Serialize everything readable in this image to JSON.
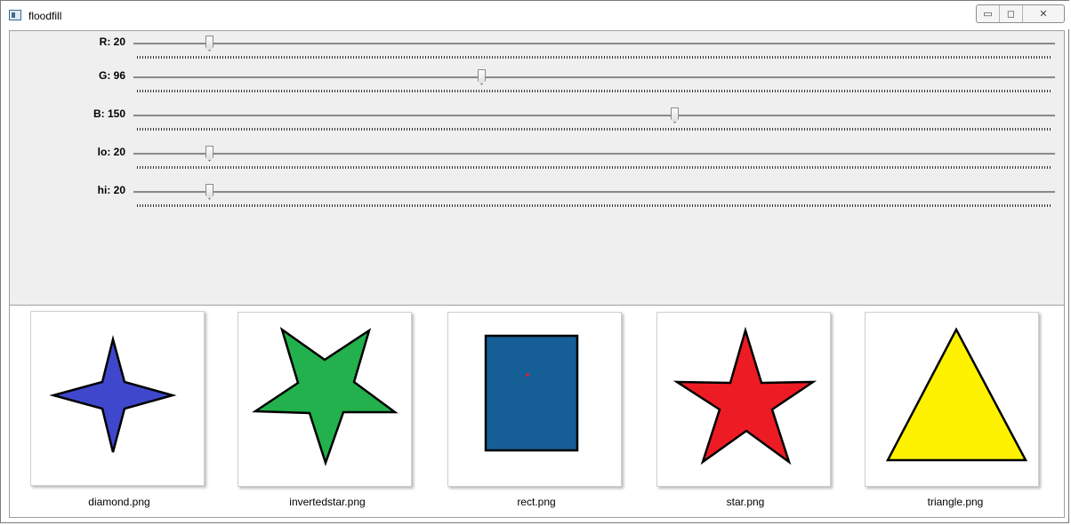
{
  "window": {
    "title": "floodfill",
    "buttons": {
      "minimize": "▭",
      "maximize": "◻",
      "close": "✕"
    }
  },
  "sliders": [
    {
      "label": "R: 20",
      "value": 20,
      "max": 255
    },
    {
      "label": "G: 96",
      "value": 96,
      "max": 255
    },
    {
      "label": "B: 150",
      "value": 150,
      "max": 255
    },
    {
      "label": "lo: 20",
      "value": 20,
      "max": 255
    },
    {
      "label": "hi: 20",
      "value": 20,
      "max": 255
    }
  ],
  "images": [
    {
      "name": "diamond.png",
      "shape": "diamond-star",
      "fill": "#3f48cc"
    },
    {
      "name": "invertedstar.png",
      "shape": "inverted-star",
      "fill": "#22b14c"
    },
    {
      "name": "rect.png",
      "shape": "rectangle",
      "fill": "#155f96",
      "seed_color": "#ed1c24"
    },
    {
      "name": "star.png",
      "shape": "star",
      "fill": "#ed1c24"
    },
    {
      "name": "triangle.png",
      "shape": "triangle",
      "fill": "#fff200"
    }
  ]
}
